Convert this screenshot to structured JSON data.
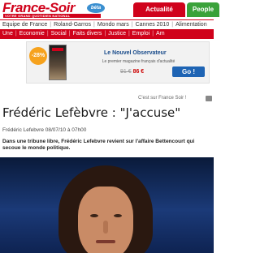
{
  "header": {
    "logo": "France-Soir",
    "tagline": "VOTRE GRAND QUOTIDIEN NATIONAL",
    "beta": "béta",
    "tabs": [
      "Actualité",
      "People"
    ]
  },
  "nav": {
    "primary": [
      "Equipe de France",
      "Roland-Garros",
      "Mondo mars",
      "Cannes 2010",
      "Alimentation"
    ],
    "secondary": [
      "Une",
      "Economie",
      "Social",
      "Faits divers",
      "Justice",
      "Emploi",
      "Am"
    ]
  },
  "ad": {
    "badge": "-28%",
    "title": "Le Nouvel Observateur",
    "subtitle": "Le premier magazine français d'actualité",
    "old_price": "91 €",
    "new_price": "86 €",
    "cta": "Go !"
  },
  "share": {
    "label": "C'est sur France Soir !"
  },
  "article": {
    "headline": "Frédéric Lefèbvre : \"J'accuse\"",
    "byline": "Frédéric Lefebvre 08/07/10 à 07h00",
    "lead": "Dans une tribune libre, Frédéric Lefebvre revient sur l'affaire Bettencourt qui secoue le monde politique."
  }
}
